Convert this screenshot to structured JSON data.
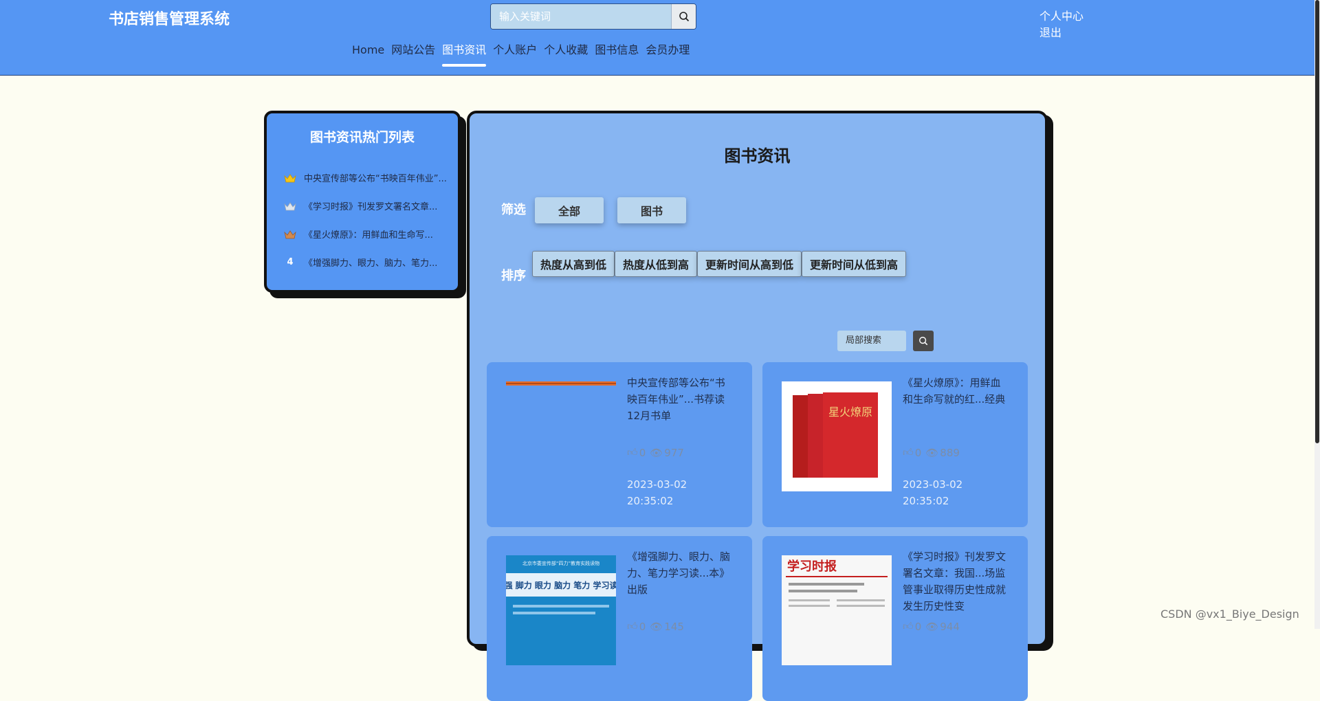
{
  "header": {
    "site_title": "书店销售管理系统",
    "search_placeholder": "输入关键词",
    "user_center": "个人中心",
    "logout": "退出"
  },
  "nav": {
    "items": [
      "Home",
      "网站公告",
      "图书资讯",
      "个人账户",
      "个人收藏",
      "图书信息",
      "会员办理"
    ],
    "active": "图书资讯"
  },
  "hot_list": {
    "title": "图书资讯热门列表",
    "items": [
      {
        "rank": "",
        "rank_icon": "gold-crown-icon",
        "text": "中央宣传部等公布“书映百年伟业”..."
      },
      {
        "rank": "",
        "rank_icon": "silver-crown-icon",
        "text": "《学习时报》刊发罗文署名文章..."
      },
      {
        "rank": "",
        "rank_icon": "bronze-crown-icon",
        "text": "《星火燎原》：用鲜血和生命写..."
      },
      {
        "rank": "4",
        "rank_icon": "",
        "text": "《增强脚力、眼力、脑力、笔力..."
      }
    ]
  },
  "main": {
    "title": "图书资讯",
    "filter_label": "筛选",
    "filters": [
      "全部",
      "图书"
    ],
    "sort_label": "排序",
    "sorts": [
      "热度从高到低",
      "热度从低到高",
      "更新时间从高到低",
      "更新时间从低到高"
    ],
    "local_search_placeholder": "局部搜索"
  },
  "cards": [
    {
      "title": "中央宣传部等公布“书映百年伟业”...书荐读12月书单",
      "likes": "0",
      "views": "977",
      "date": "2023-03-02 20:35:02"
    },
    {
      "title": "《星火燎原》：用鲜血和生命写就的红...经典",
      "likes": "0",
      "views": "889",
      "date": "2023-03-02 20:35:02"
    },
    {
      "title": "《增强脚力、眼力、脑力、笔力学习读...本》出版",
      "likes": "0",
      "views": "145",
      "date": ""
    },
    {
      "title": "《学习时报》刊发罗文署名文章：我国...场监管事业取得历史性成就发生历史性变",
      "likes": "0",
      "views": "944",
      "date": ""
    }
  ],
  "card_images": {
    "book3_series": "北京市委宣传部“四力”教育实践读物",
    "book3_cover": "增强 脚力 眼力 脑力 笔力 学习读本",
    "book2_cover": "星火燎原",
    "newspaper_mast": "学习时报"
  },
  "watermark": "CSDN @vx1_Biye_Design",
  "colors": {
    "header_bg": "#5596f3",
    "page_bg": "#fdfdf2",
    "panel_bg": "#87b5f2",
    "card_bg": "#5e9af0",
    "button_bg": "#b9d6ee"
  }
}
